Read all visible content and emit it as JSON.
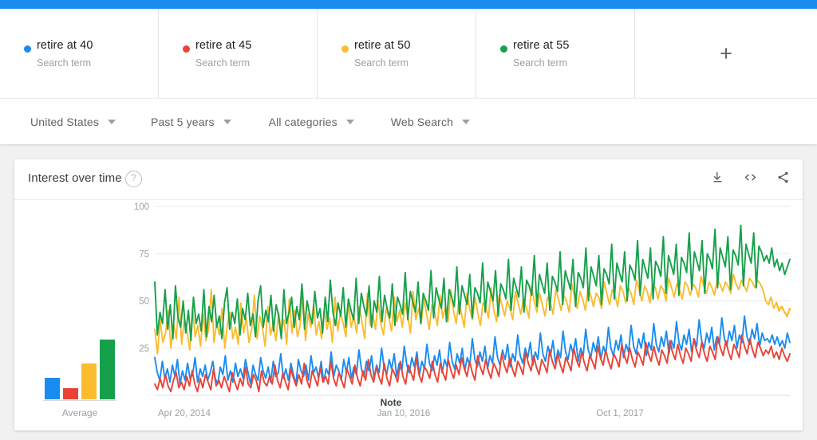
{
  "header": {
    "terms": [
      {
        "label": "retire at 40",
        "sublabel": "Search term",
        "color": "#1a8cf0"
      },
      {
        "label": "retire at 45",
        "sublabel": "Search term",
        "color": "#ea4335"
      },
      {
        "label": "retire at 50",
        "sublabel": "Search term",
        "color": "#fbbc2e"
      },
      {
        "label": "retire at 55",
        "sublabel": "Search term",
        "color": "#17a04c"
      }
    ],
    "add_label": "+"
  },
  "filters": [
    {
      "label": "United States",
      "icon": "chevron-down-icon"
    },
    {
      "label": "Past 5 years",
      "icon": "chevron-down-icon"
    },
    {
      "label": "All categories",
      "icon": "chevron-down-icon"
    },
    {
      "label": "Web Search",
      "icon": "chevron-down-icon"
    }
  ],
  "card": {
    "title": "Interest over time",
    "help_icon": "?",
    "actions": [
      {
        "name": "download-icon",
        "title": "Download"
      },
      {
        "name": "embed-icon",
        "title": "Embed"
      },
      {
        "name": "share-icon",
        "title": "Share"
      }
    ]
  },
  "chart_data": {
    "type": "line",
    "title": "Interest over time",
    "xlabel": "",
    "ylabel": "",
    "ylim": [
      0,
      100
    ],
    "yticks": [
      25,
      50,
      75,
      100
    ],
    "grid": true,
    "legend_position": "top",
    "xtick_labels": [
      "Apr 20, 2014",
      "Jan 10, 2016",
      "Oct 1, 2017"
    ],
    "xtick_positions": [
      0.0,
      0.345,
      0.69
    ],
    "annotations": [
      {
        "text": "Note",
        "x": 0.355,
        "y": 3
      }
    ],
    "average_label": "Average",
    "averages": [
      18,
      9,
      30,
      50
    ],
    "series": [
      {
        "name": "retire at 40",
        "color": "#1a8cf0",
        "values": [
          20,
          12,
          8,
          18,
          9,
          14,
          7,
          16,
          10,
          19,
          6,
          13,
          8,
          17,
          9,
          11,
          20,
          7,
          14,
          10,
          16,
          8,
          12,
          18,
          9,
          6,
          15,
          11,
          21,
          8,
          13,
          7,
          17,
          10,
          14,
          9,
          19,
          12,
          6,
          16,
          11,
          8,
          20,
          13,
          9,
          15,
          7,
          18,
          10,
          12,
          22,
          9,
          14,
          8,
          17,
          11,
          6,
          19,
          13,
          10,
          16,
          8,
          21,
          12,
          15,
          9,
          18,
          7,
          14,
          11,
          23,
          10,
          16,
          13,
          8,
          19,
          12,
          20,
          9,
          15,
          11,
          24,
          14,
          10,
          18,
          13,
          21,
          9,
          16,
          12,
          25,
          15,
          11,
          19,
          14,
          22,
          10,
          17,
          13,
          26,
          16,
          12,
          20,
          15,
          23,
          11,
          18,
          14,
          27,
          17,
          13,
          21,
          16,
          24,
          12,
          19,
          15,
          28,
          18,
          14,
          22,
          17,
          25,
          13,
          20,
          16,
          30,
          19,
          15,
          23,
          18,
          26,
          14,
          21,
          17,
          31,
          20,
          16,
          24,
          19,
          27,
          15,
          22,
          18,
          32,
          21,
          17,
          25,
          20,
          28,
          16,
          23,
          19,
          33,
          22,
          18,
          26,
          21,
          29,
          17,
          24,
          20,
          34,
          23,
          19,
          27,
          22,
          30,
          18,
          25,
          21,
          35,
          24,
          20,
          28,
          23,
          31,
          19,
          26,
          22,
          36,
          25,
          21,
          29,
          24,
          32,
          20,
          27,
          23,
          37,
          26,
          22,
          30,
          25,
          33,
          21,
          28,
          24,
          38,
          27,
          23,
          31,
          26,
          34,
          22,
          29,
          25,
          39,
          28,
          24,
          32,
          27,
          35,
          23,
          30,
          26,
          40,
          29,
          25,
          33,
          28,
          36,
          24,
          31,
          27,
          41,
          30,
          26,
          34,
          29,
          37,
          25,
          32,
          28,
          42,
          31,
          27,
          35,
          30,
          38,
          26,
          33,
          29,
          30,
          28,
          32,
          27,
          31,
          26,
          29,
          25,
          33,
          28
        ]
      },
      {
        "name": "retire at 45",
        "color": "#ea4335",
        "values": [
          6,
          3,
          9,
          4,
          11,
          5,
          2,
          8,
          12,
          4,
          7,
          3,
          10,
          5,
          13,
          6,
          2,
          9,
          4,
          11,
          7,
          3,
          14,
          5,
          8,
          4,
          10,
          6,
          2,
          12,
          7,
          3,
          9,
          5,
          15,
          6,
          4,
          11,
          8,
          2,
          13,
          7,
          5,
          10,
          6,
          16,
          8,
          4,
          12,
          7,
          3,
          14,
          9,
          5,
          11,
          6,
          17,
          8,
          4,
          13,
          9,
          5,
          15,
          7,
          10,
          6,
          18,
          9,
          5,
          12,
          8,
          4,
          14,
          10,
          6,
          16,
          9,
          5,
          13,
          8,
          19,
          11,
          7,
          15,
          10,
          6,
          17,
          9,
          5,
          14,
          11,
          7,
          18,
          10,
          6,
          16,
          12,
          8,
          20,
          11,
          7,
          15,
          13,
          9,
          18,
          11,
          7,
          17,
          12,
          8,
          19,
          13,
          9,
          16,
          11,
          20,
          14,
          10,
          18,
          12,
          8,
          21,
          15,
          11,
          19,
          13,
          9,
          17,
          14,
          10,
          22,
          16,
          12,
          20,
          14,
          10,
          18,
          15,
          11,
          23,
          17,
          13,
          21,
          15,
          11,
          19,
          16,
          12,
          24,
          18,
          14,
          22,
          16,
          12,
          20,
          17,
          13,
          25,
          19,
          15,
          23,
          17,
          13,
          21,
          18,
          14,
          26,
          20,
          16,
          24,
          18,
          14,
          22,
          19,
          15,
          27,
          21,
          17,
          25,
          19,
          15,
          23,
          20,
          16,
          28,
          22,
          18,
          26,
          20,
          16,
          24,
          21,
          17,
          29,
          23,
          19,
          27,
          21,
          17,
          25,
          22,
          18,
          30,
          24,
          20,
          28,
          22,
          18,
          26,
          23,
          19,
          31,
          25,
          21,
          29,
          23,
          19,
          27,
          24,
          20,
          32,
          26,
          22,
          30,
          24,
          20,
          28,
          25,
          21,
          24,
          22,
          26,
          20,
          23,
          19,
          25,
          21,
          18,
          22
        ]
      },
      {
        "name": "retire at 50",
        "color": "#fbbc2e",
        "values": [
          35,
          22,
          40,
          28,
          33,
          45,
          25,
          38,
          30,
          52,
          27,
          41,
          34,
          24,
          47,
          31,
          37,
          26,
          43,
          29,
          35,
          56,
          28,
          39,
          32,
          46,
          25,
          38,
          44,
          30,
          36,
          27,
          49,
          33,
          41,
          28,
          35,
          53,
          30,
          42,
          36,
          26,
          47,
          32,
          38,
          29,
          44,
          34,
          40,
          27,
          51,
          33,
          45,
          31,
          37,
          55,
          29,
          43,
          36,
          48,
          32,
          39,
          30,
          46,
          35,
          41,
          28,
          52,
          34,
          44,
          38,
          31,
          49,
          36,
          42,
          33,
          47,
          39,
          30,
          54,
          37,
          43,
          35,
          50,
          38,
          32,
          46,
          41,
          34,
          52,
          39,
          45,
          36,
          49,
          42,
          33,
          55,
          40,
          46,
          38,
          51,
          43,
          35,
          48,
          44,
          37,
          53,
          41,
          47,
          39,
          56,
          45,
          38,
          50,
          43,
          36,
          54,
          46,
          40,
          52,
          44,
          37,
          49,
          47,
          41,
          57,
          45,
          39,
          53,
          48,
          42,
          50,
          46,
          40,
          55,
          49,
          43,
          51,
          47,
          41,
          58,
          50,
          44,
          54,
          48,
          42,
          52,
          49,
          43,
          56,
          51,
          45,
          53,
          50,
          44,
          59,
          52,
          46,
          55,
          51,
          45,
          57,
          53,
          47,
          54,
          52,
          46,
          60,
          54,
          48,
          56,
          53,
          47,
          58,
          55,
          49,
          57,
          54,
          48,
          61,
          56,
          50,
          58,
          55,
          49,
          59,
          57,
          51,
          58,
          56,
          50,
          62,
          57,
          52,
          59,
          56,
          51,
          60,
          58,
          53,
          59,
          57,
          52,
          63,
          58,
          54,
          60,
          57,
          53,
          61,
          59,
          55,
          60,
          58,
          54,
          64,
          59,
          56,
          61,
          58,
          55,
          62,
          60,
          57,
          61,
          59,
          56,
          50,
          48,
          52,
          46,
          49,
          45,
          47,
          44,
          42,
          46
        ]
      },
      {
        "name": "retire at 55",
        "color": "#17a04c",
        "values": [
          60,
          32,
          44,
          38,
          56,
          35,
          48,
          30,
          58,
          41,
          36,
          50,
          33,
          45,
          29,
          52,
          38,
          43,
          34,
          56,
          31,
          47,
          39,
          53,
          36,
          42,
          30,
          49,
          57,
          35,
          44,
          38,
          51,
          32,
          46,
          40,
          54,
          37,
          43,
          31,
          50,
          58,
          36,
          45,
          39,
          53,
          34,
          48,
          42,
          30,
          56,
          38,
          44,
          52,
          36,
          47,
          40,
          59,
          35,
          50,
          43,
          38,
          55,
          41,
          46,
          33,
          52,
          39,
          61,
          44,
          37,
          49,
          42,
          57,
          36,
          51,
          45,
          40,
          62,
          38,
          54,
          47,
          42,
          58,
          36,
          50,
          44,
          63,
          39,
          53,
          46,
          41,
          59,
          37,
          52,
          48,
          43,
          65,
          40,
          55,
          49,
          44,
          60,
          38,
          54,
          50,
          45,
          66,
          41,
          57,
          51,
          46,
          62,
          39,
          56,
          52,
          47,
          68,
          43,
          58,
          53,
          48,
          64,
          41,
          57,
          54,
          49,
          70,
          44,
          60,
          55,
          50,
          66,
          42,
          59,
          56,
          51,
          72,
          45,
          62,
          57,
          52,
          68,
          44,
          61,
          58,
          53,
          74,
          47,
          64,
          59,
          54,
          70,
          45,
          63,
          60,
          55,
          76,
          48,
          66,
          61,
          56,
          72,
          47,
          65,
          62,
          57,
          78,
          50,
          68,
          63,
          58,
          74,
          48,
          67,
          64,
          59,
          80,
          51,
          70,
          65,
          60,
          76,
          50,
          69,
          66,
          61,
          82,
          53,
          72,
          67,
          62,
          78,
          51,
          71,
          68,
          63,
          84,
          54,
          74,
          69,
          64,
          80,
          53,
          73,
          70,
          65,
          86,
          56,
          76,
          71,
          66,
          82,
          54,
          75,
          72,
          67,
          88,
          57,
          78,
          73,
          68,
          84,
          56,
          77,
          74,
          69,
          90,
          58,
          80,
          75,
          70,
          86,
          57,
          79,
          76,
          71,
          74,
          70,
          78,
          68,
          72,
          66,
          70,
          64,
          68,
          72
        ]
      }
    ]
  }
}
